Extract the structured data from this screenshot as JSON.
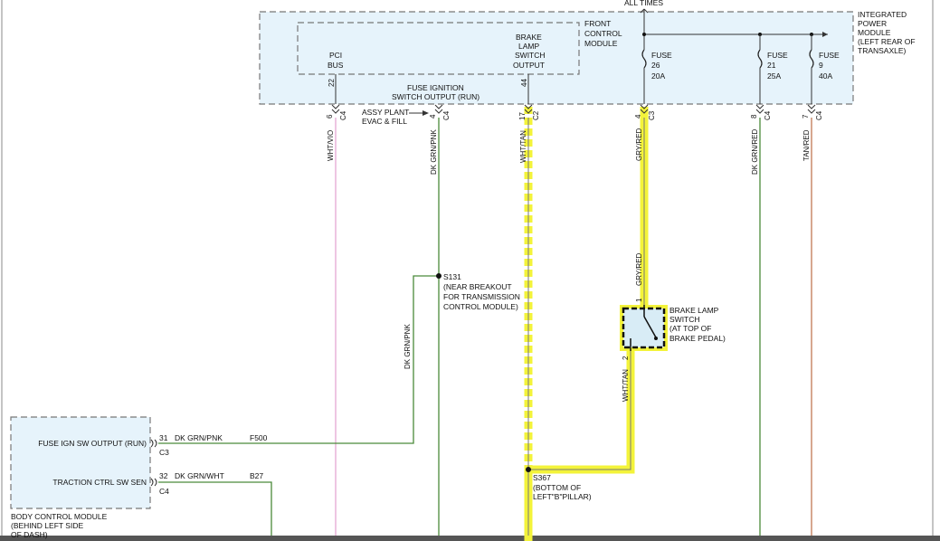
{
  "header": {
    "always_hot": "ALL TIMES"
  },
  "ipm": {
    "title": [
      "INTEGRATED",
      "POWER",
      "MODULE",
      "(LEFT REAR OF",
      "TRANSAXLE)"
    ]
  },
  "fcm": {
    "title": [
      "FRONT",
      "CONTROL",
      "MODULE"
    ]
  },
  "pci_bus": {
    "label": [
      "PCI",
      "BUS"
    ],
    "pin": "22"
  },
  "brake_output": {
    "label": [
      "BRAKE",
      "LAMP",
      "SWITCH",
      "OUTPUT"
    ],
    "pin": "44"
  },
  "fuse_ign_output": {
    "label": [
      "FUSE IGNITION",
      "SWITCH OUTPUT (RUN)"
    ]
  },
  "fuses": [
    {
      "label": [
        "FUSE",
        "26",
        "20A"
      ]
    },
    {
      "label": [
        "FUSE",
        "21",
        "25A"
      ]
    },
    {
      "label": [
        "FUSE",
        "9",
        "40A"
      ]
    }
  ],
  "assy_plant": [
    "ASSY PLANT",
    "EVAC & FILL"
  ],
  "connectors": [
    {
      "pin": "6",
      "conn": "C4",
      "wire": "WHT/VIO"
    },
    {
      "pin": "4",
      "conn": "C4",
      "wire": "DK GRN/PNK"
    },
    {
      "pin": "17",
      "conn": "C2",
      "wire": "WHT/TAN"
    },
    {
      "pin": "4",
      "conn": "C3",
      "wire": "GRY/RED"
    },
    {
      "pin": "8",
      "conn": "C4",
      "wire": "DK GRN/RED"
    },
    {
      "pin": "7",
      "conn": "C4",
      "wire": "TAN/RED"
    }
  ],
  "splice_s131": {
    "label": [
      "S131",
      "(NEAR BREAKOUT",
      "FOR TRANSMISSION",
      "CONTROL MODULE)"
    ],
    "wire": "DK GRN/PNK"
  },
  "brake_switch": {
    "label": [
      "BRAKE LAMP",
      "SWITCH",
      "(AT TOP OF",
      "BRAKE PEDAL)"
    ],
    "pin_in": "1",
    "pin_out": "2",
    "wire_in": "GRY/RED",
    "wire_out": "WHT/TAN"
  },
  "splice_s367": {
    "label": [
      "S367",
      "(BOTTOM OF",
      "LEFT\"B\"PILLAR)"
    ]
  },
  "bcm": {
    "title": [
      "BODY CONTROL MODULE",
      "(BEHIND LEFT SIDE",
      "OF DASH)"
    ],
    "pins": [
      {
        "label": "FUSE IGN SW OUTPUT (RUN)",
        "pin": "31",
        "wire": "DK GRN/PNK",
        "circuit": "F500",
        "conn": "C3"
      },
      {
        "label": "TRACTION CTRL SW SEN",
        "pin": "32",
        "wire": "DK GRN/WHT",
        "circuit": "B27",
        "conn": "C4"
      }
    ]
  },
  "colors": {
    "highlight": "#f3f33a",
    "module_fill": "#e6f3fb",
    "wire_green": "#4a8a3a",
    "wire_pink": "#e8b4d8",
    "wire_tan": "#c98a6a"
  }
}
